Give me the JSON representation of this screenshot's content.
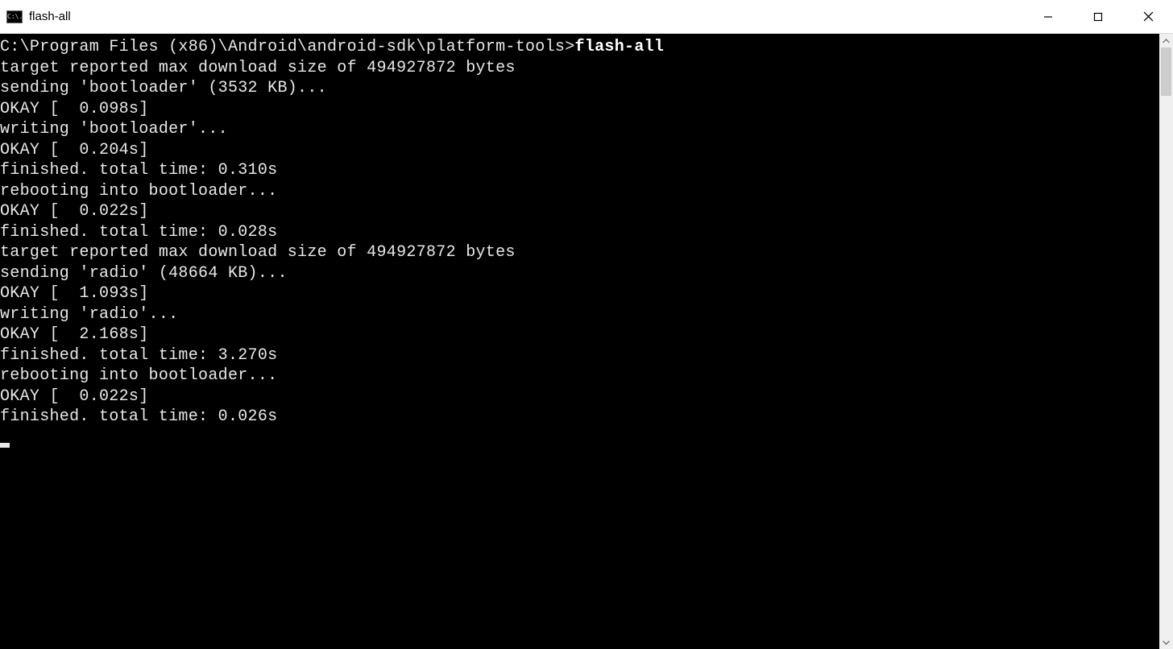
{
  "window": {
    "title": "flash-all",
    "icon_label": "C:\\."
  },
  "terminal": {
    "prompt_path": "C:\\Program Files (x86)\\Android\\android-sdk\\platform-tools>",
    "command": "flash-all",
    "lines": [
      "target reported max download size of 494927872 bytes",
      "sending 'bootloader' (3532 KB)...",
      "OKAY [  0.098s]",
      "writing 'bootloader'...",
      "OKAY [  0.204s]",
      "finished. total time: 0.310s",
      "rebooting into bootloader...",
      "OKAY [  0.022s]",
      "finished. total time: 0.028s",
      "target reported max download size of 494927872 bytes",
      "sending 'radio' (48664 KB)...",
      "OKAY [  1.093s]",
      "writing 'radio'...",
      "OKAY [  2.168s]",
      "finished. total time: 3.270s",
      "rebooting into bootloader...",
      "OKAY [  0.022s]",
      "finished. total time: 0.026s"
    ]
  }
}
